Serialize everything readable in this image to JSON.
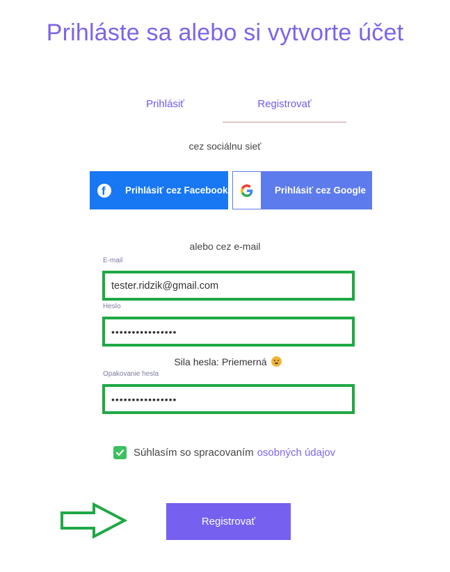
{
  "page": {
    "title": "Prihláste sa alebo si vytvorte účet"
  },
  "tabs": [
    {
      "label": "Prihlásiť",
      "active": false
    },
    {
      "label": "Registrovať",
      "active": true
    }
  ],
  "social": {
    "caption": "cez sociálnu sieť",
    "facebook_label": "Prihlásiť cez Facebook",
    "google_label": "Prihlásiť cez Google",
    "facebook_color": "#1877f2",
    "google_color": "#5d7bec"
  },
  "email_section": {
    "caption": "alebo cez e-mail",
    "email_label": "E-mail",
    "email_value": "tester.ridzik@gmail.com",
    "password_label": "Heslo",
    "password_value": "••••••••••••••••",
    "strength_text": "Sila hesla: Priemerná",
    "repeat_label": "Opakovanie hesla",
    "repeat_value": "••••••••••••••••"
  },
  "consent": {
    "checked": true,
    "text": "Súhlasím so spracovaním",
    "link_text": "osobných údajov"
  },
  "submit": {
    "label": "Registrovať"
  },
  "colors": {
    "accent": "#7560f0",
    "highlight": "#1fa845"
  }
}
